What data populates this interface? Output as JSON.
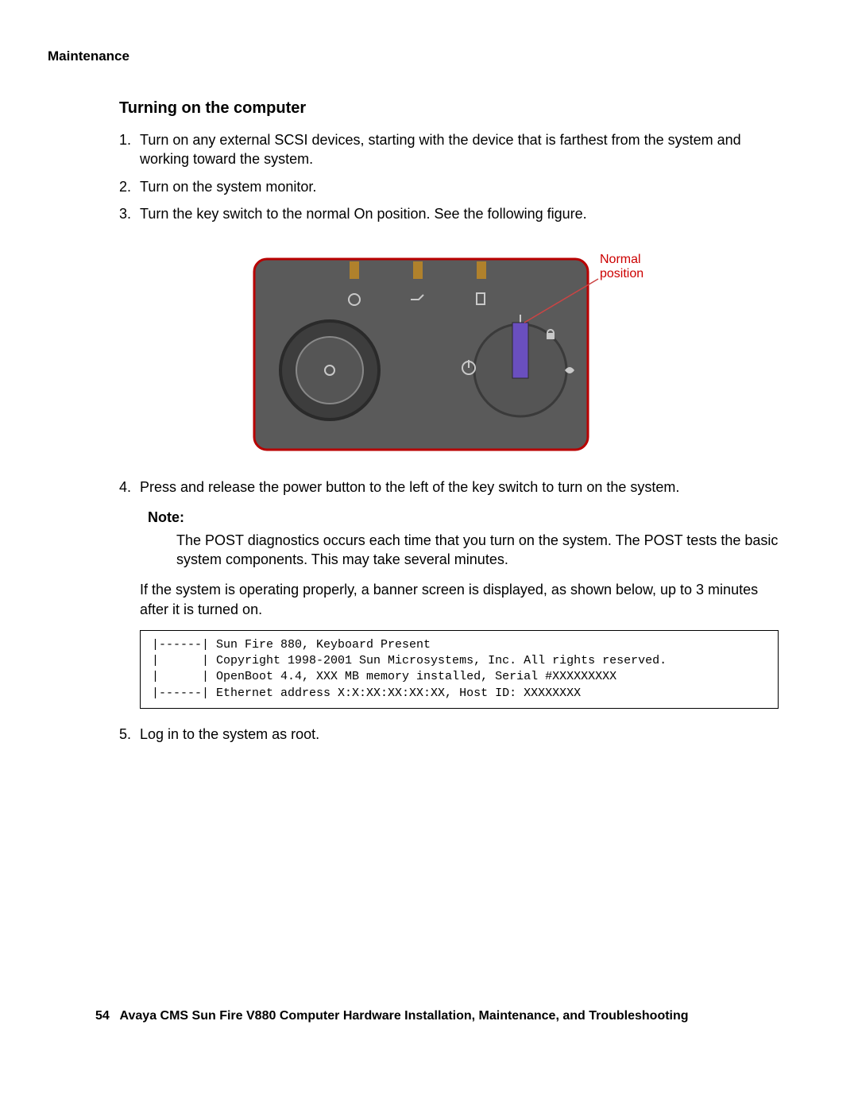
{
  "header": "Maintenance",
  "title": "Turning on the computer",
  "steps": {
    "n1": "1.",
    "t1": "Turn on any external SCSI devices, starting with the device that is farthest from the system and working toward the system.",
    "n2": "2.",
    "t2": "Turn on the system monitor.",
    "n3": "3.",
    "t3": "Turn the key switch to the normal On position. See the following figure.",
    "n4": "4.",
    "t4": "Press and release the power button to the left of the key switch to turn on the system.",
    "n5": "5.",
    "t5": "Log in to the system as root."
  },
  "figure_label": {
    "line1": "Normal",
    "line2": "position"
  },
  "note_label": "Note:",
  "note_body": "The POST diagnostics occurs each time that you turn on the system. The POST tests the basic system components. This may take several minutes.",
  "banner_intro": "If the system is operating properly, a banner screen is displayed, as shown below, up to 3 minutes after it is turned on.",
  "banner_text": "|------| Sun Fire 880, Keyboard Present\n|      | Copyright 1998-2001 Sun Microsystems, Inc. All rights reserved.\n|      | OpenBoot 4.4, XXX MB memory installed, Serial #XXXXXXXXX\n|------| Ethernet address X:X:XX:XX:XX:XX, Host ID: XXXXXXXX",
  "footer_page": "54",
  "footer_text": "Avaya CMS Sun Fire V880 Computer Hardware Installation, Maintenance, and Troubleshooting"
}
